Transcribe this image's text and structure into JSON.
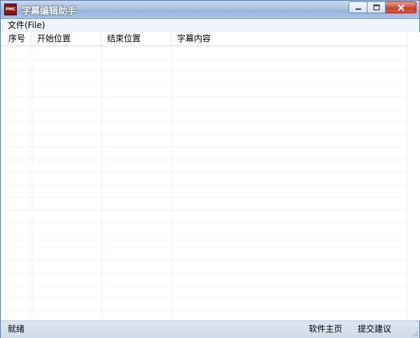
{
  "window": {
    "title": "字幕编辑助手",
    "icon_text": "PMC"
  },
  "menu": {
    "file": "文件(File)"
  },
  "table": {
    "columns": [
      "序号",
      "开始位置",
      "结束位置",
      "字幕内容"
    ],
    "rows": []
  },
  "status": {
    "ready": "就绪",
    "home": "软件主页",
    "suggest": "提交建议"
  },
  "colors": {
    "title_bar": "#aec4e2",
    "close_button": "#c8402a",
    "status_bar": "#d6e0ee"
  }
}
